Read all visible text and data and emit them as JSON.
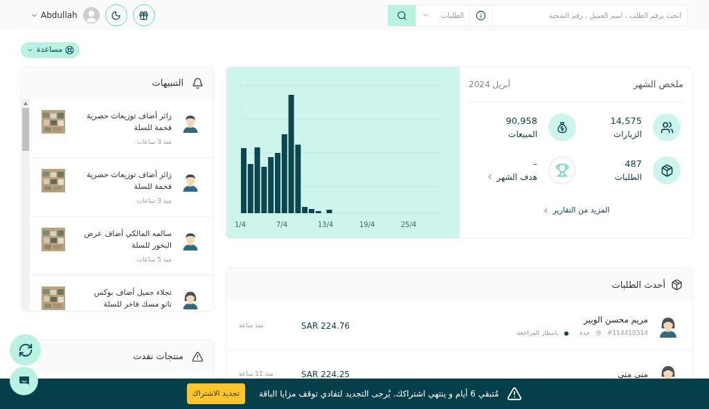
{
  "header": {
    "search": {
      "placeholder": "ابحث برقم الطلب ، اسم العميل ، رقم الشحنة"
    },
    "scope": "الطلبات",
    "user": "Abdullah"
  },
  "help": "مساعدة",
  "alerts": {
    "title": "التنبيهات",
    "items": [
      {
        "kind": "male",
        "text": "زائر أضاف توزيعات حصرية فخمة للسلة",
        "time": "منذ 3 ساعات"
      },
      {
        "kind": "male",
        "text": "زائر أضاف توزيعات حصرية فخمة للسلة",
        "time": "منذ 3 ساعات"
      },
      {
        "kind": "male",
        "text": "سالمه المالكي أضاف عرض البخور للسلة",
        "time": "منذ 5 ساعات"
      },
      {
        "kind": "female",
        "text": "نجلاء جميل أضاف بوكس نانو مسك فاخر للسلة"
      }
    ]
  },
  "out_of_stock": {
    "title": "منتجات نفدت"
  },
  "summary": {
    "title": "ملخص الشهر",
    "period": "أبريل 2024",
    "stats": [
      {
        "kind": "visits",
        "value": "14,575",
        "label": "الزيارات"
      },
      {
        "kind": "sales",
        "value": "90,958",
        "label": "المبيعات"
      },
      {
        "kind": "orders",
        "value": "487",
        "label": "الطلبات"
      },
      {
        "kind": "goal",
        "value": "–",
        "label": "هدف الشهر"
      }
    ],
    "more_link": "المزيد من التقارير",
    "chart_x_labels": [
      "25/4",
      "19/4",
      "13/4",
      "7/4",
      "1/4"
    ]
  },
  "orders": {
    "title": "أحدث الطلبات",
    "rows": [
      {
        "kind": "female",
        "name": "مريم محسن الوبير",
        "order_no": "#114410314",
        "city": "جدة",
        "status": "بانتظار المراجعة",
        "color": "#1f3b3b",
        "amount": "SAR 224.76",
        "time": "منذ ساعة"
      },
      {
        "kind": "female",
        "name": "منى منى",
        "amount": "SAR 224.25",
        "time": "منذ 11 ساعة"
      }
    ]
  },
  "banner": {
    "message": "مُتبقي 6 أيام و ينتهي اشتراكك. يُرجى التجديد لتفادي توقف مزايا الباقة",
    "button": "تجديد الاشتراك"
  }
}
